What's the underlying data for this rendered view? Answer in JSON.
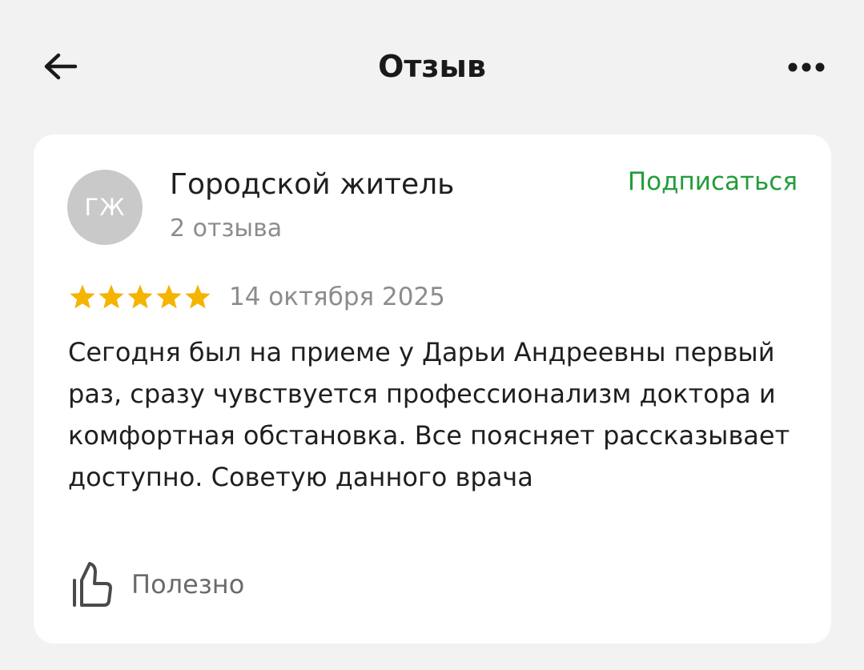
{
  "header": {
    "title": "Отзыв",
    "back_icon": "arrow-left-icon",
    "more_icon": "more-dots-icon"
  },
  "review": {
    "author": {
      "initials": "ГЖ",
      "name": "Городской житель",
      "reviews_count": "2 отзыва"
    },
    "subscribe_label": "Подписаться",
    "rating": 5,
    "rating_max": 5,
    "date": "14 октября 2025",
    "text": "Сегодня был на приеме у Дарьи Андреевны первый раз, сразу чувствуется профессионализм доктора и комфортная обстановка. Все поясняет рассказывает доступно. Советую данного врача",
    "useful_label": "Полезно",
    "useful_icon": "thumbs-up-icon"
  },
  "colors": {
    "background": "#f2f2f2",
    "card": "#ffffff",
    "accent": "#219d3a",
    "star": "#f4b400",
    "avatar": "#c9c9c9",
    "muted_text": "#8c8c8c"
  }
}
